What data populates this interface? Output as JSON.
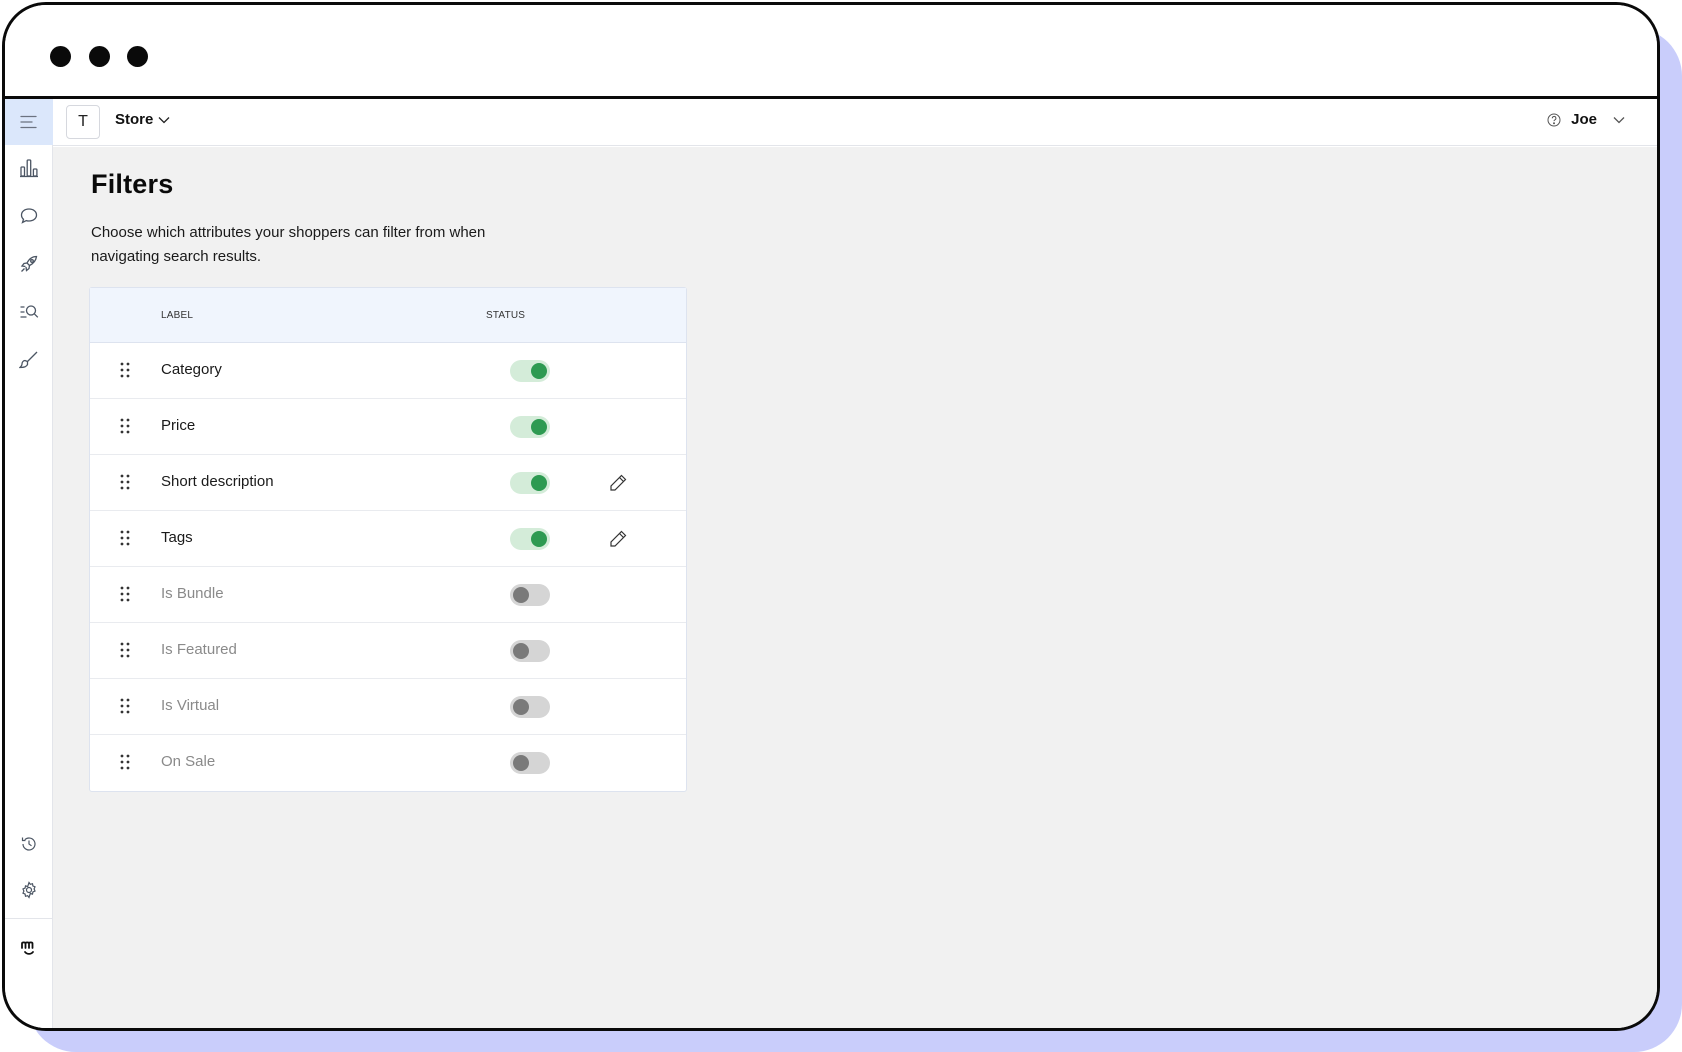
{
  "colors": {
    "accent_shadow": "#c9cdfb",
    "sidebar_active": "#dbe7fb",
    "toggle_on_knob": "#2e9a52",
    "toggle_on_track": "#d4ecd9",
    "toggle_off_knob": "#7a7a7a",
    "toggle_off_track": "#d5d5d5",
    "header_row": "#f0f5fd"
  },
  "window": {
    "controls": [
      "close",
      "minimize",
      "maximize"
    ]
  },
  "sidebar": {
    "items": [
      {
        "icon": "menu-icon",
        "active": true
      },
      {
        "icon": "analytics-icon"
      },
      {
        "icon": "chat-icon"
      },
      {
        "icon": "rocket-icon"
      },
      {
        "icon": "search-list-icon"
      },
      {
        "icon": "brush-icon"
      }
    ],
    "bottom_items": [
      {
        "icon": "history-icon"
      },
      {
        "icon": "gear-icon"
      },
      {
        "icon": "logo-icon"
      }
    ]
  },
  "topbar": {
    "store_initial": "T",
    "store_label": "Store",
    "user_name": "Joe"
  },
  "page": {
    "title": "Filters",
    "description": "Choose which attributes your shoppers can filter from when navigating search results."
  },
  "table": {
    "headers": {
      "label": "LABEL",
      "status": "STATUS"
    },
    "rows": [
      {
        "label": "Category",
        "enabled": true,
        "editable": false
      },
      {
        "label": "Price",
        "enabled": true,
        "editable": false
      },
      {
        "label": "Short description",
        "enabled": true,
        "editable": true
      },
      {
        "label": "Tags",
        "enabled": true,
        "editable": true
      },
      {
        "label": "Is Bundle",
        "enabled": false,
        "editable": false
      },
      {
        "label": "Is Featured",
        "enabled": false,
        "editable": false
      },
      {
        "label": "Is Virtual",
        "enabled": false,
        "editable": false
      },
      {
        "label": "On Sale",
        "enabled": false,
        "editable": false
      }
    ]
  }
}
